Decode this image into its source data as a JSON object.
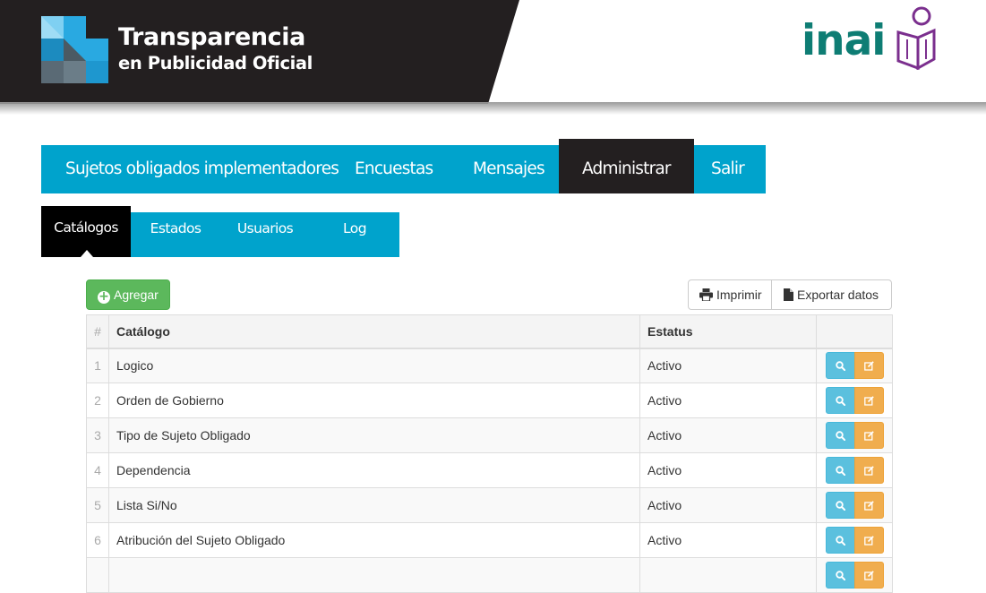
{
  "header": {
    "brand_title": "Transparencia",
    "brand_subtitle": "en Publicidad Oficial",
    "logo_icon": "tpo-logo-icon",
    "partner_logo_text": "inai",
    "partner_logo_icon": "inai-book-figure-icon",
    "colors": {
      "dark": "#231f20",
      "white": "#ffffff",
      "inai_teal": "#0e7d74",
      "inai_purple": "#7b2f8e"
    }
  },
  "main_nav": {
    "items": [
      {
        "label": "Sujetos obligados implementadores",
        "active": false
      },
      {
        "label": "Encuestas",
        "active": false
      },
      {
        "label": "Mensajes",
        "active": false
      },
      {
        "label": "Administrar",
        "active": true
      },
      {
        "label": "Salir",
        "active": false
      }
    ],
    "colors": {
      "bar": "#00a3cc",
      "active": "#231f20"
    }
  },
  "sub_nav": {
    "items": [
      {
        "label": "Catálogos",
        "active": true
      },
      {
        "label": "Estados",
        "active": false
      },
      {
        "label": "Usuarios",
        "active": false
      },
      {
        "label": "Log",
        "active": false
      }
    ]
  },
  "toolbar": {
    "add_label": "Agregar",
    "add_icon": "plus-circle-icon",
    "print_label": "Imprimir",
    "print_icon": "printer-icon",
    "export_label": "Exportar datos",
    "export_icon": "file-icon",
    "colors": {
      "success": "#5cb85c",
      "info": "#5bc0de",
      "warning": "#f0ad4e"
    }
  },
  "table": {
    "headers": {
      "num": "#",
      "catalog": "Catálogo",
      "status": "Estatus",
      "actions": ""
    },
    "rows": [
      {
        "num": "1",
        "catalog": "Logico",
        "status": "Activo"
      },
      {
        "num": "2",
        "catalog": "Orden de Gobierno",
        "status": "Activo"
      },
      {
        "num": "3",
        "catalog": "Tipo de Sujeto Obligado",
        "status": "Activo"
      },
      {
        "num": "4",
        "catalog": "Dependencia",
        "status": "Activo"
      },
      {
        "num": "5",
        "catalog": "Lista Si/No",
        "status": "Activo"
      },
      {
        "num": "6",
        "catalog": "Atribución del Sujeto Obligado",
        "status": "Activo"
      },
      {
        "num": "",
        "catalog": "",
        "status": ""
      }
    ],
    "row_action_icons": [
      "search-icon",
      "edit-icon"
    ]
  }
}
